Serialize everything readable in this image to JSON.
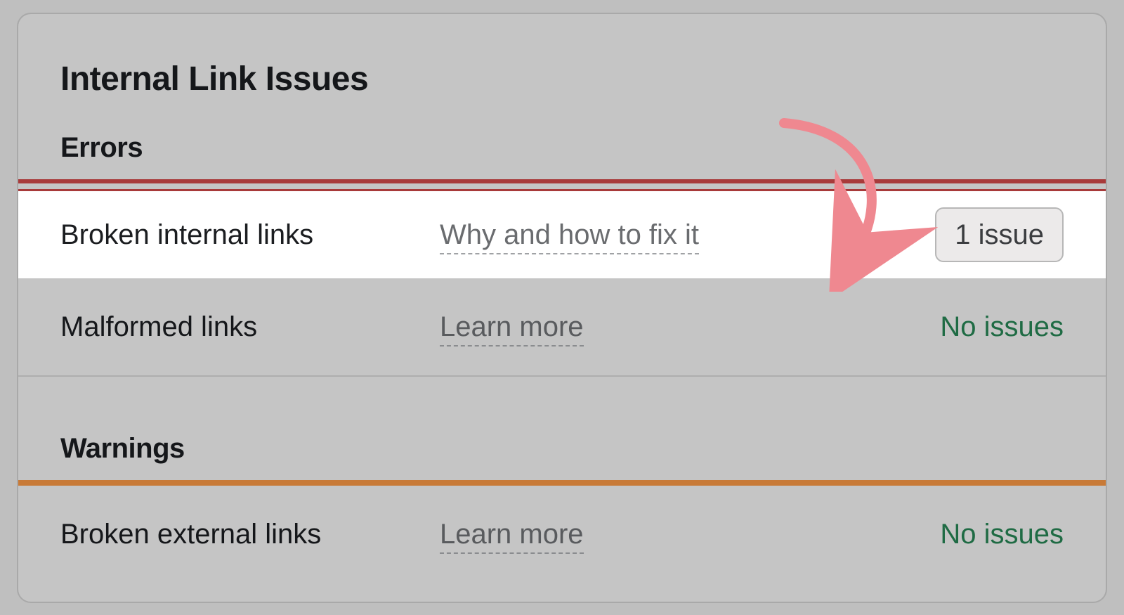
{
  "panel": {
    "title": "Internal Link Issues",
    "sections": [
      {
        "header": "Errors",
        "rule": "error",
        "rows": [
          {
            "name": "Broken internal links",
            "link": "Why and how to fix it",
            "status_type": "pill",
            "status_text": "1 issue",
            "highlight": true
          },
          {
            "name": "Malformed links",
            "link": "Learn more",
            "status_type": "ok",
            "status_text": "No issues",
            "highlight": false
          }
        ]
      },
      {
        "header": "Warnings",
        "rule": "warning",
        "rows": [
          {
            "name": "Broken external links",
            "link": "Learn more",
            "status_type": "ok",
            "status_text": "No issues",
            "highlight": false
          }
        ]
      }
    ]
  },
  "colors": {
    "error_rule": "#a83a3a",
    "warning_rule": "#c87a37",
    "ok_text": "#1f6b44",
    "annotation_arrow": "#ef8890"
  }
}
